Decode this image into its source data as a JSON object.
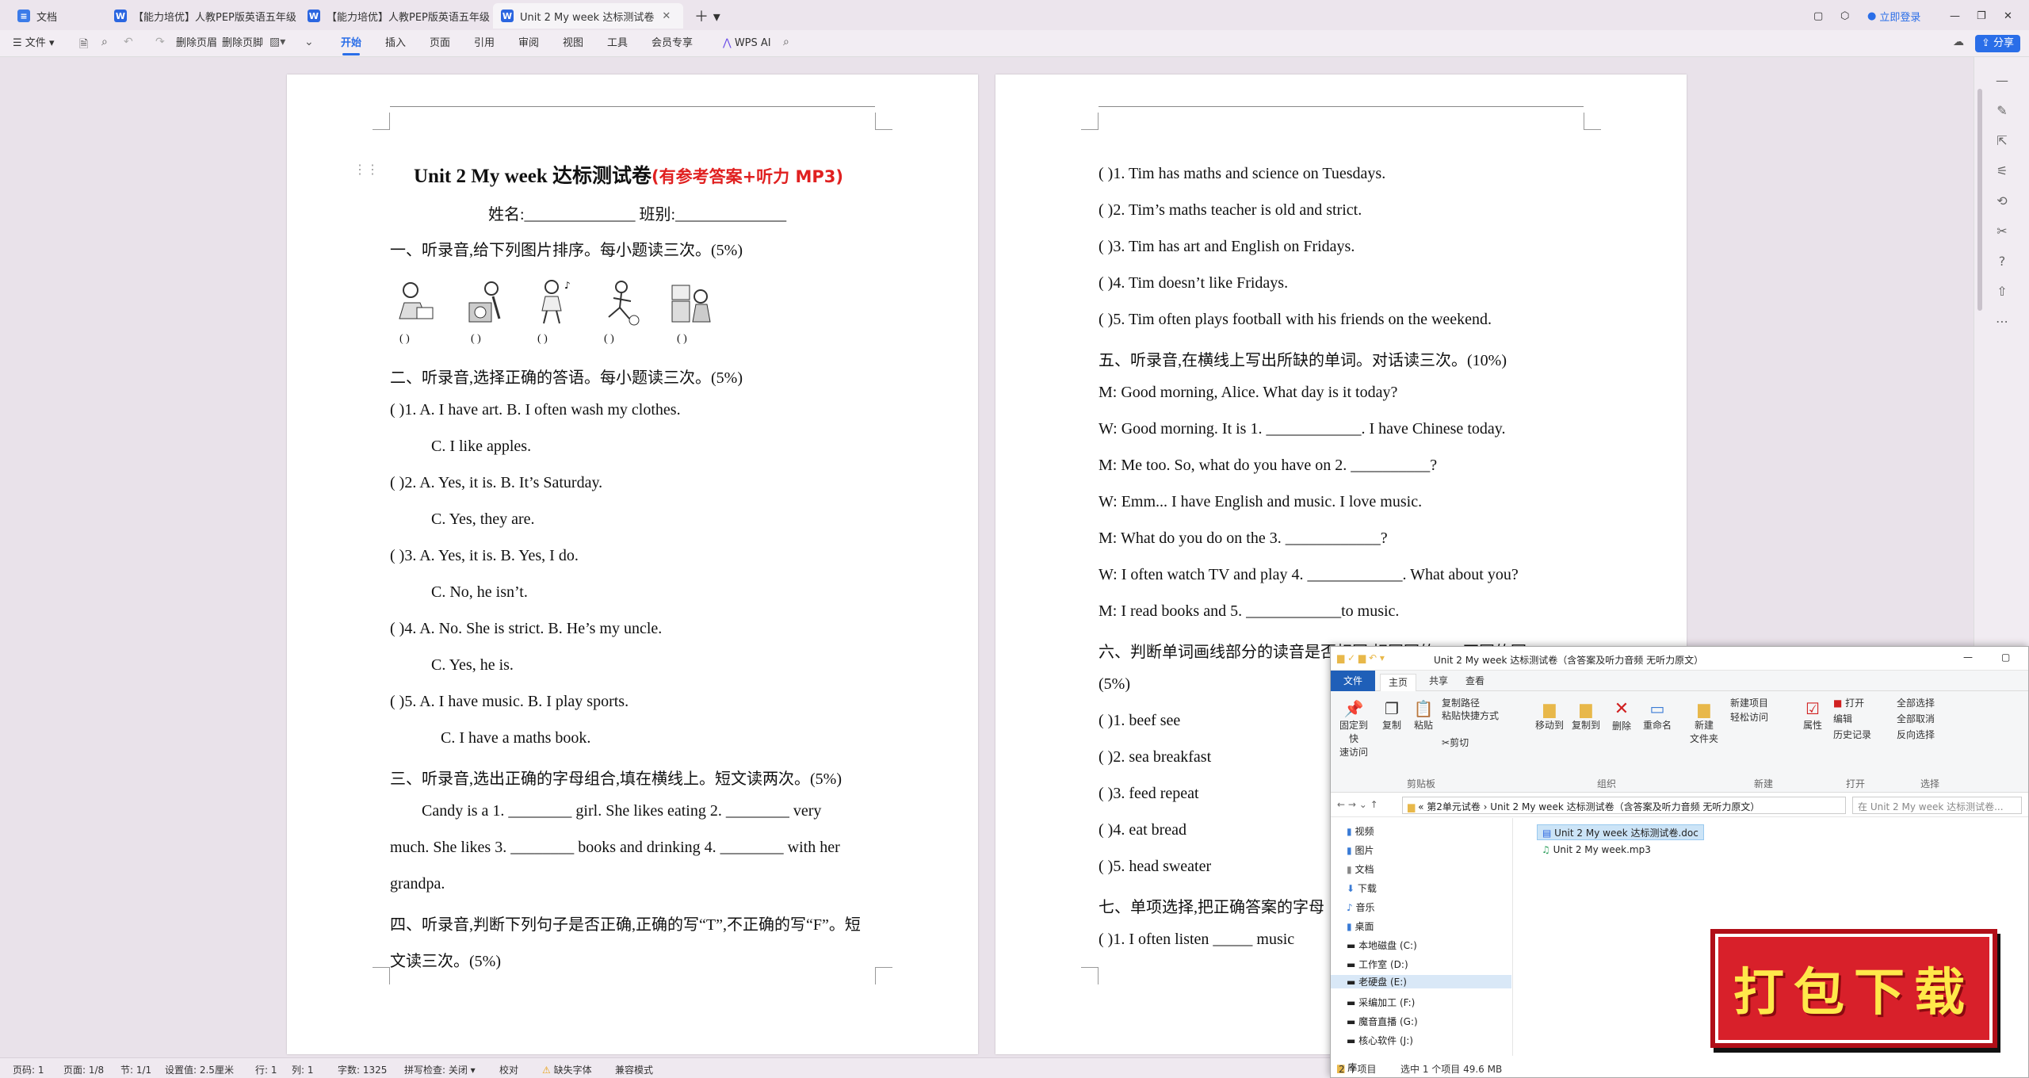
{
  "tabs": [
    {
      "label": "文档",
      "icon": "docs-home-icon"
    },
    {
      "label": "【能力培优】人教PEP版英语五年级上",
      "icon": "word-doc-icon"
    },
    {
      "label": "【能力培优】人教PEP版英语五年级上",
      "icon": "word-doc-icon"
    },
    {
      "label": "Unit 2 My week 达标测试卷",
      "icon": "word-doc-icon"
    }
  ],
  "topright": {
    "login": "立即登录",
    "share": "分享"
  },
  "menu": {
    "file": "文件",
    "delete_header": "删除页眉",
    "delete_footer": "删除页脚",
    "items": [
      "开始",
      "插入",
      "页面",
      "引用",
      "审阅",
      "视图",
      "工具",
      "会员专享"
    ],
    "wps_ai": "WPS AI"
  },
  "doc": {
    "title": "Unit 2 My week  达标测试卷",
    "title_red": "(有参考答案+听力 MP3)",
    "name_line": "姓名:______________      班别:______________",
    "q1": "一、听录音,给下列图片排序。每小题读三次。(5%)",
    "q1_brackets": [
      "(    )",
      "(    )",
      "(    )",
      "(    )",
      "(    )"
    ],
    "q2": "二、听录音,选择正确的答语。每小题读三次。(5%)",
    "q2_lines": [
      "(        )1. A. I have art.     B. I often wash my clothes.",
      "C. I like apples.",
      "(        )2. A. Yes, it is.   B. It’s Saturday.",
      "C. Yes, they are.",
      "(        )3. A. Yes, it is.              B. Yes, I do.",
      "C. No, he isn’t.",
      "(        )4. A. No. She is strict.   B. He’s my uncle.",
      "C. Yes, he is.",
      "(        )5. A. I have music.        B. I play sports.",
      "C. I have a maths book."
    ],
    "q3": "三、听录音,选出正确的字母组合,填在横线上。短文读两次。(5%)",
    "q3_lines": [
      "Candy is a 1. ________ girl. She likes eating 2. ________     very",
      "much. She likes 3. ________ books and drinking 4. ________ with her",
      "grandpa."
    ],
    "q4": "四、听录音,判断下列句子是否正确,正确的写“T”,不正确的写“F”。短",
    "q4b": "文读三次。(5%)",
    "p2_lines": [
      "(         )1. Tim has maths and science on Tuesdays.",
      "(         )2. Tim’s maths teacher is old and strict.",
      "(         )3. Tim has art and English on Fridays.",
      "(         )4. Tim doesn’t like Fridays.",
      "(         )5. Tim often plays football with his friends on the         weekend.",
      "五、听录音,在横线上写出所缺的单词。对话读三次。(10%)",
      "M: Good morning, Alice. What day is it today?",
      "W: Good morning. It is 1. ____________. I have Chinese today.",
      "M: Me too. So, what do you have on 2. __________?",
      "W: Emm... I have English and music. I love music.",
      "M: What do you do on the 3. ____________?",
      "W: I often watch TV and play 4. ____________.    What about you?",
      "M: I read books and 5. ____________to music.",
      "六、判断单词画线部分的读音是否相同,相同写的“T”,不同的写“F”。",
      "(5%)",
      "(         )1. beef              see",
      "(         )2. sea               breakfast",
      "(         )3. feed              repeat",
      "(         )4. eat                bread",
      "(         )5. head              sweater",
      "七、单项选择,把正确答案的字母",
      "(         )1. I often listen _____ music"
    ]
  },
  "status": [
    "页码: 1",
    "页面: 1/8",
    "节: 1/1",
    "设置值: 2.5厘米",
    "行: 1",
    "列: 1",
    "字数: 1325",
    "拼写检查: 关闭",
    "校对",
    "缺失字体",
    "兼容模式"
  ],
  "explorer": {
    "title": "Unit 2 My week 达标测试卷（含答案及听力音频 无听力原文）",
    "tabs": [
      "文件",
      "主页",
      "共享",
      "查看"
    ],
    "ribbon": {
      "pin": "固定到快\n速访问",
      "copy": "复制",
      "paste": "粘贴",
      "copy_path": "复制路径",
      "paste_shortcut": "粘贴快捷方式",
      "cut": "剪切",
      "move_to": "移动到",
      "copy_to": "复制到",
      "delete": "删除",
      "rename": "重命名",
      "new_folder": "新建\n文件夹",
      "new_item": "新建项目",
      "easy_access": "轻松访问",
      "properties": "属性",
      "open": "打开",
      "edit": "编辑",
      "history": "历史记录",
      "select_all": "全部选择",
      "select_none": "全部取消",
      "invert": "反向选择"
    },
    "groups": [
      "剪贴板",
      "组织",
      "新建",
      "打开",
      "选择"
    ],
    "address": "«  第2单元试卷  ›  Unit 2 My week 达标测试卷（含答案及听力音频 无听力原文）",
    "search_placeholder": "在 Unit 2 My week 达标测试卷...",
    "nav": [
      "视频",
      "图片",
      "文档",
      "下载",
      "音乐",
      "桌面",
      "本地磁盘 (C:)",
      "工作室 (D:)",
      "老硬盘 (E:)",
      "采编加工 (F:)",
      "魔音直播 (G:)",
      "核心软件 (J:)",
      "库"
    ],
    "files": [
      "Unit 2 My week 达标测试卷.doc",
      "Unit 2 My week.mp3"
    ],
    "status_count": "2 个项目",
    "status_sel": "选中 1 个项目  49.6 MB"
  },
  "badge": "打包下载",
  "colors": {
    "accent": "#2a6ee8",
    "badge": "#d8202a",
    "title_red": "#e02020"
  }
}
